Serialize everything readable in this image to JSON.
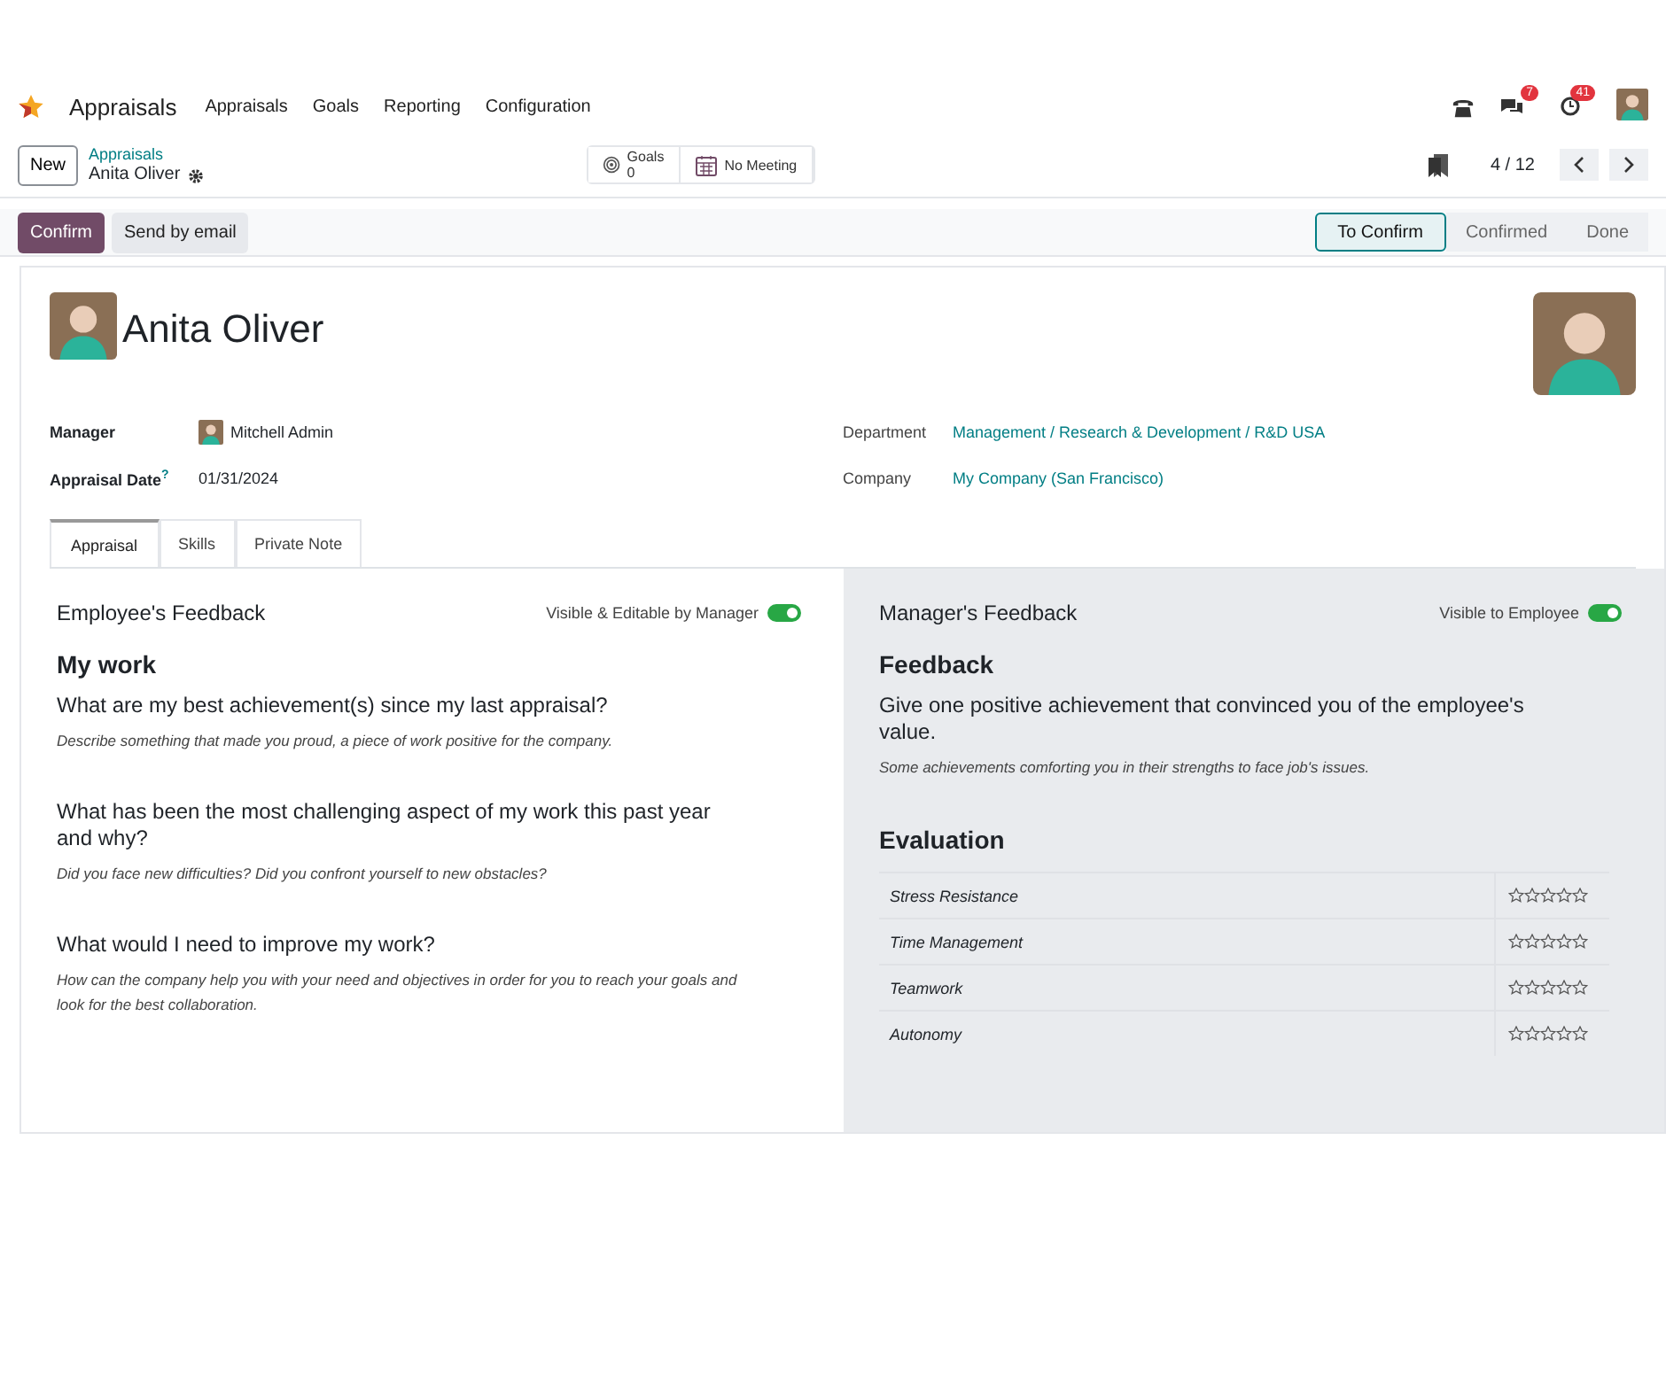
{
  "navbar": {
    "app_name": "Appraisals",
    "menu": [
      "Appraisals",
      "Goals",
      "Reporting",
      "Configuration"
    ],
    "messages_badge": "7",
    "activities_badge": "41"
  },
  "control_panel": {
    "new_button": "New",
    "breadcrumb_parent": "Appraisals",
    "breadcrumb_current": "Anita Oliver",
    "smart_buttons": [
      {
        "kind": "stat",
        "label": "Goals",
        "value": "0"
      },
      {
        "kind": "meeting",
        "label": "No Meeting"
      }
    ],
    "pager": "4 / 12"
  },
  "actions": [
    {
      "kind": "primary",
      "label": "Confirm"
    },
    {
      "kind": "secondary",
      "label": "Send by email"
    }
  ],
  "stages": [
    {
      "label": "To Confirm",
      "selected": true
    },
    {
      "label": "Confirmed",
      "selected": false
    },
    {
      "label": "Done",
      "selected": false
    }
  ],
  "sheet": {
    "name": "Anita Oliver",
    "left_fields": [
      {
        "label": "Manager",
        "value": "Mitchell Admin",
        "kind": "user"
      },
      {
        "label": "Appraisal Date",
        "help": "?",
        "value": "01/31/2024",
        "kind": "text"
      }
    ],
    "right_fields": [
      {
        "label": "Department",
        "value": "Management / Research & Development / R&D USA",
        "kind": "link"
      },
      {
        "label": "Company",
        "value": "My Company (San Francisco)",
        "kind": "link"
      }
    ],
    "tabs": [
      {
        "label": "Appraisal",
        "selected": true
      },
      {
        "label": "Skills",
        "selected": false
      },
      {
        "label": "Private Note",
        "selected": false
      }
    ],
    "employee_panel": {
      "title": "Employee's Feedback",
      "toggle_label": "Visible & Editable by Manager",
      "on": true,
      "section": "My work",
      "questions": [
        {
          "question": "What are my best achievement(s) since my last appraisal?",
          "hint": "Describe something that made you proud, a piece of work positive for the company."
        },
        {
          "question": "What has been the most challenging aspect of my work this past year and why?",
          "hint": "Did you face new difficulties? Did you confront yourself to new obstacles?"
        },
        {
          "question": "What would I need to improve my work?",
          "hint": "How can the company help you with your need and objectives in order for you to reach your goals and look for the best collaboration."
        }
      ]
    },
    "manager_panel": {
      "title": "Manager's Feedback",
      "toggle_label": "Visible to Employee",
      "on": true,
      "section": "Feedback",
      "questions": [
        {
          "question": "Give one positive achievement that convinced you of the employee's value.",
          "hint": "Some achievements comforting you in their strengths to face job's issues."
        }
      ],
      "evaluation_title": "Evaluation",
      "skills": [
        {
          "name": "Stress Resistance",
          "stars": 0
        },
        {
          "name": "Time Management",
          "stars": 0
        },
        {
          "name": "Teamwork",
          "stars": 0
        },
        {
          "name": "Autonomy",
          "stars": 0
        }
      ]
    }
  }
}
